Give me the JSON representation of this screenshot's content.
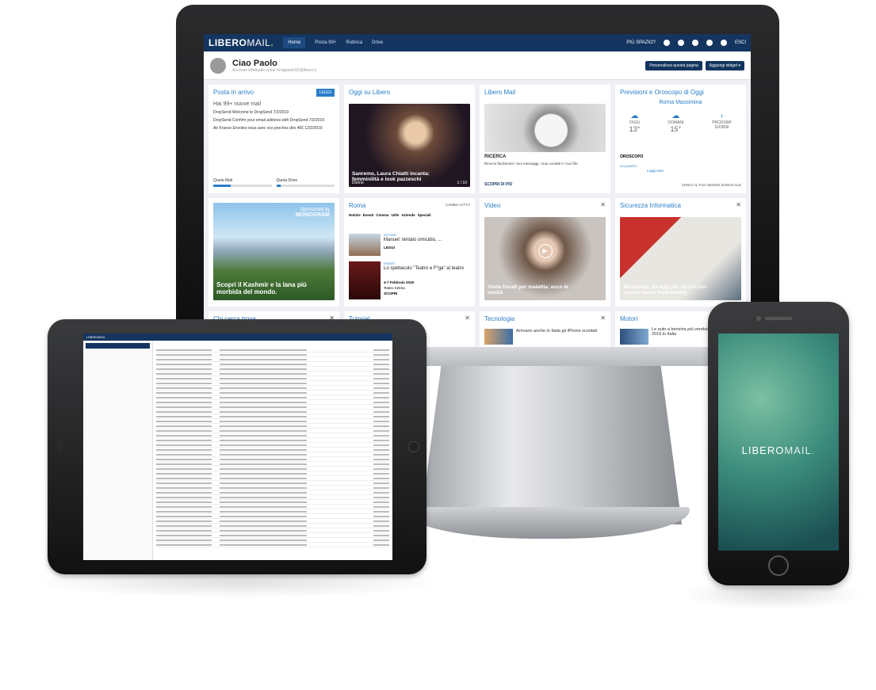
{
  "desktop": {
    "logo_main": "LIBERO",
    "logo_mail": "MAIL",
    "nav": [
      "Home",
      "Posta",
      "Rubrica",
      "Drive"
    ],
    "nav_badge": "99+",
    "top_right": {
      "promo": "PIÙ SPAZIO?",
      "exit": "ESCI"
    },
    "greeting": "Ciao Paolo",
    "greeting_sub": "Accesso effettuato come fenigpaolo92@libero.it",
    "buttons": {
      "customize": "Personalizza questa pagina",
      "add_widget": "Aggiungi widget ▾"
    },
    "cards": {
      "inbox": {
        "title": "Posta in arrivo",
        "action": "LEGGI",
        "headline": "Hai 99+ nuove mail",
        "lines": [
          "DropSend Welcome to DropSend 7/2/2019",
          "DropSend Confirm your email address with DropSend 7/2/2019",
          "Air France Envolez-vous avec vos proches dès 46€ 12/2/2019"
        ],
        "quota_mail": "Quota Mail",
        "quota_drive": "Quota Drive"
      },
      "today": {
        "title": "Oggi su Libero",
        "caption": "Sanremo, Laura Chiatti incanta: femminilità e look pazzeschi",
        "tag": "Donne",
        "count": "1 / 10"
      },
      "libero_mail": {
        "title": "Libero Mail",
        "heading": "RICERCA",
        "text": "Ricerca facilmente i tuoi messaggi, i tuoi contatti e i tuoi file.",
        "link": "SCOPRI DI PIÙ"
      },
      "weather": {
        "title": "Previsioni e Oroscopo di Oggi",
        "city": "Roma Massimina",
        "today_label": "OGGI",
        "today_temp": "13°",
        "tomorrow_label": "DOMANI",
        "tomorrow_temp": "15°",
        "next_label": "PROSSIMI GIORNI",
        "horoscope": "OROSCOPO",
        "sign": "ACQUARIO",
        "read": "Leggi tutto",
        "footer": "CERCA IL TUO SEGNO ZODIACALE"
      },
      "ad": {
        "sponsor": "Sponsored by",
        "brand": "MONOGRAM",
        "caption": "Scopri il Kashmir e la lana più morbida del mondo."
      },
      "roma": {
        "title": "Roma",
        "change": "CAMBIA CITTÀ",
        "tabs": [
          "Notizie",
          "Eventi",
          "Cinema",
          "Utile",
          "Aziende",
          "Speciali"
        ],
        "item1_tag": "NOTIZIE",
        "item1_title": "Manuel: tentato omicidio, ...",
        "item1_link": "LEGGI",
        "item2_tag": "EVENTI",
        "item2_title": "Lo spettacolo \"Teatro e F*ga\" al teatro",
        "item2_date": "4-7 Febbraio 2019",
        "item2_venue": "Teatro Ketma",
        "item2_link": "SCOPRI"
      },
      "video": {
        "title": "Video",
        "caption": "Visite fiscali per malattia: ecco le novità"
      },
      "security": {
        "title": "Sicurezza Informatica",
        "caption": "WhatsApp, da oggi più sicuro con questa nuova funzionalità"
      },
      "who": {
        "title": "Chi cerca trova"
      },
      "tutorial": {
        "title": "Tutorial"
      },
      "tech": {
        "title": "Tecnologia",
        "text": "Arrivano anche in Italia gli iPhone scontati"
      },
      "motori": {
        "title": "Motori",
        "text": "Le auto a benzina più vendute a gennaio 2019 in Italia"
      }
    }
  },
  "tablet": {
    "logo": "LIBEROMAIL"
  },
  "phone": {
    "logo_main": "LIBERO",
    "logo_mail": "MAIL"
  }
}
